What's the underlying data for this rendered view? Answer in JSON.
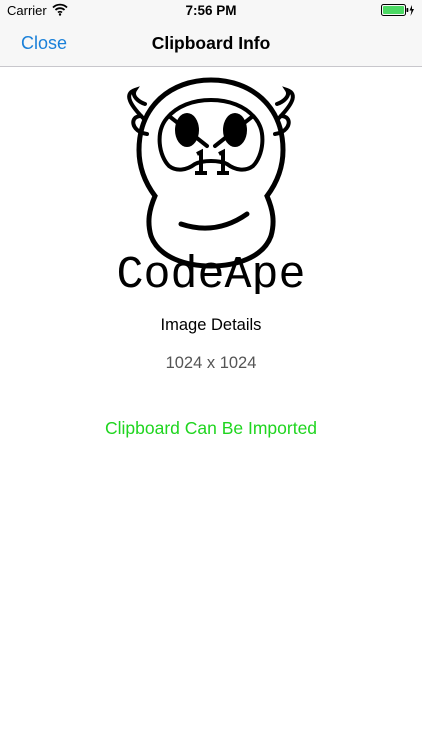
{
  "status_bar": {
    "carrier": "Carrier",
    "time": "7:56 PM",
    "wifi_icon": "wifi-icon",
    "battery_icon": "battery-charging-icon",
    "battery_color": "#4cd964"
  },
  "nav": {
    "close_label": "Close",
    "title": "Clipboard Info",
    "accent_color": "#1a80d9"
  },
  "preview": {
    "logo_text": "CodeApe",
    "logo_icon": "monkey-logo-icon"
  },
  "details": {
    "heading": "Image Details",
    "size": "1024 x 1024"
  },
  "import_status": {
    "text": "Clipboard Can Be Imported",
    "color": "#1fd51f"
  }
}
